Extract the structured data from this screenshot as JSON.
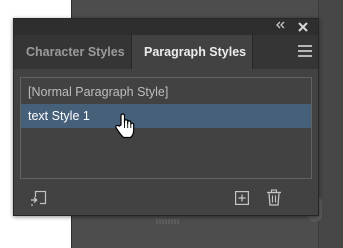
{
  "panel": {
    "tabs": [
      {
        "label": "Character Styles",
        "active": false
      },
      {
        "label": "Paragraph Styles",
        "active": true
      }
    ],
    "styles_list": [
      {
        "label": "[Normal Paragraph Style]",
        "selected": false
      },
      {
        "label": "text Style 1",
        "selected": true
      }
    ],
    "titlebar_icons": [
      "collapse-icon",
      "close-icon"
    ],
    "bottom_icons": [
      "load-styles-icon",
      "new-style-icon",
      "trash-icon"
    ]
  },
  "colors": {
    "panel_bg": "#424242",
    "tab_bar_bg": "#353535",
    "selection": "#46607a",
    "canvas_bg": "#4d4d4d"
  }
}
